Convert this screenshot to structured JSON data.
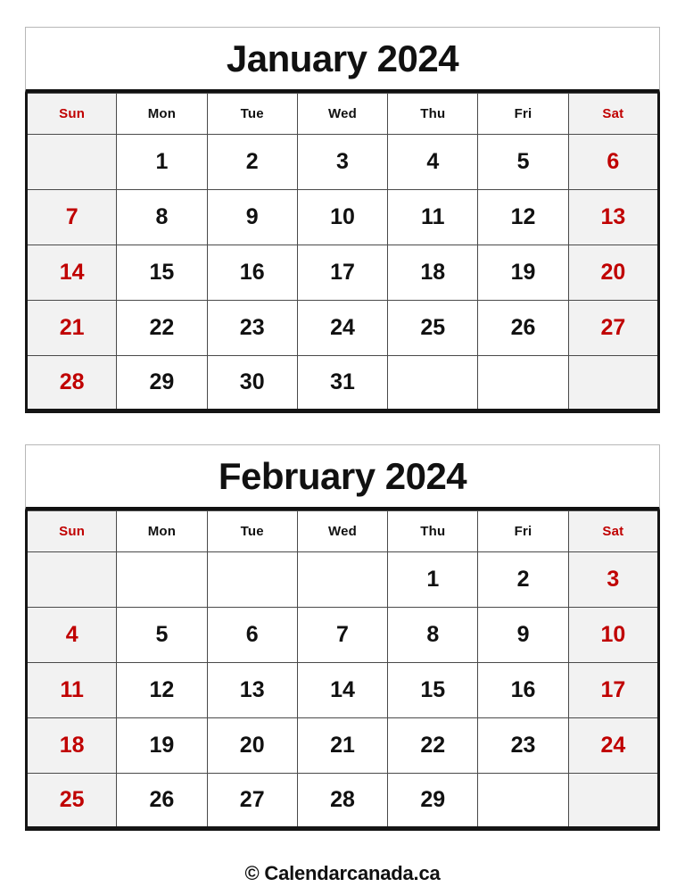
{
  "page": {
    "background": "#ffffff",
    "accent_red": "#c00000",
    "weekend_bg": "#f2f2f2",
    "text_color": "#111111"
  },
  "calendars": [
    {
      "id": "january-2024",
      "title": "January 2024",
      "weekdays": [
        "Sun",
        "Mon",
        "Tue",
        "Wed",
        "Thu",
        "Fri",
        "Sat"
      ],
      "weeks": [
        [
          "",
          "1",
          "2",
          "3",
          "4",
          "5",
          "6"
        ],
        [
          "7",
          "8",
          "9",
          "10",
          "11",
          "12",
          "13"
        ],
        [
          "14",
          "15",
          "16",
          "17",
          "18",
          "19",
          "20"
        ],
        [
          "21",
          "22",
          "23",
          "24",
          "25",
          "26",
          "27"
        ],
        [
          "28",
          "29",
          "30",
          "31",
          "",
          "",
          ""
        ]
      ]
    },
    {
      "id": "february-2024",
      "title": "February 2024",
      "weekdays": [
        "Sun",
        "Mon",
        "Tue",
        "Wed",
        "Thu",
        "Fri",
        "Sat"
      ],
      "weeks": [
        [
          "",
          "",
          "",
          "",
          "1",
          "2",
          "3"
        ],
        [
          "4",
          "5",
          "6",
          "7",
          "8",
          "9",
          "10"
        ],
        [
          "11",
          "12",
          "13",
          "14",
          "15",
          "16",
          "17"
        ],
        [
          "18",
          "19",
          "20",
          "21",
          "22",
          "23",
          "24"
        ],
        [
          "25",
          "26",
          "27",
          "28",
          "29",
          "",
          ""
        ]
      ]
    }
  ],
  "footer": {
    "copyright": "© Calendarcanada.ca"
  }
}
